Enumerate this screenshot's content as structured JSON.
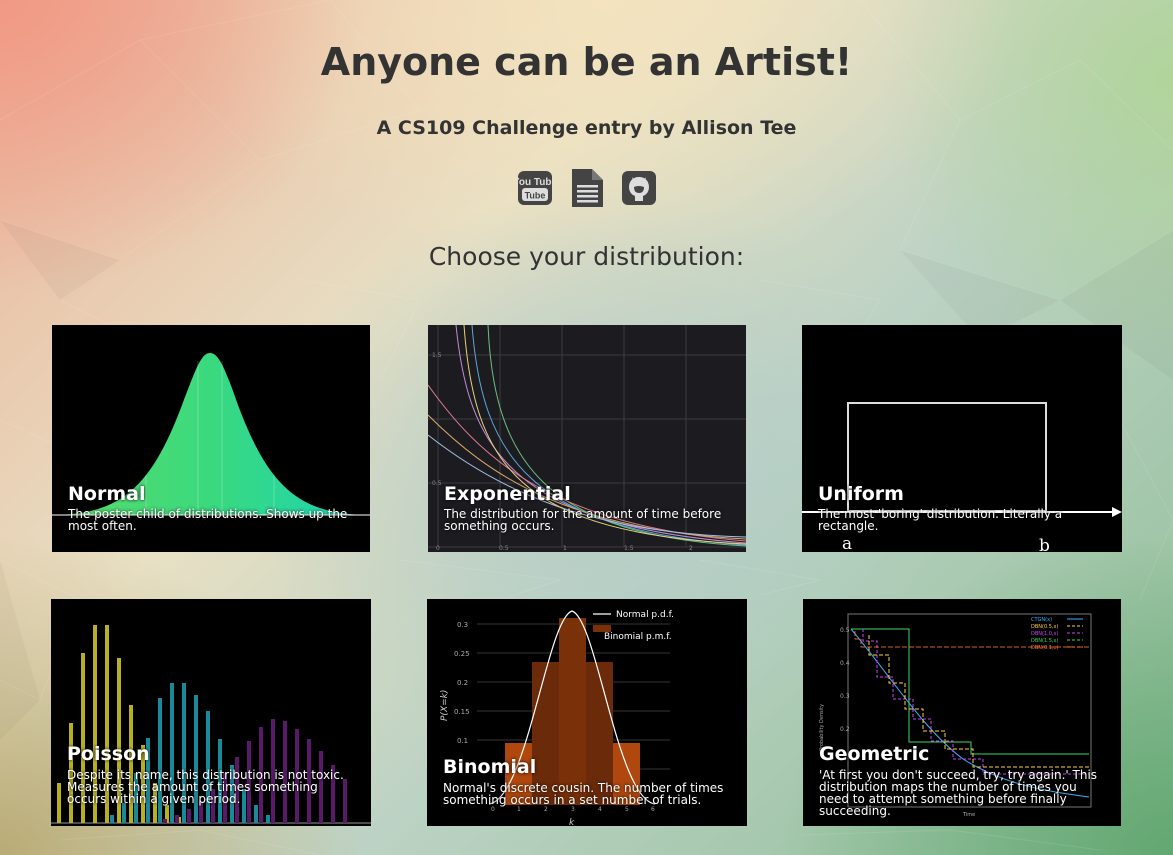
{
  "header": {
    "title": "Anyone can be an Artist!",
    "subtitle": "A CS109 Challenge entry by Allison Tee",
    "links": [
      {
        "icon": "youtube-icon",
        "label": "You Tube"
      },
      {
        "icon": "document-icon"
      },
      {
        "icon": "github-icon"
      }
    ]
  },
  "prompt": "Choose your distribution:",
  "cards": {
    "normal": {
      "name": "Normal",
      "description": "The poster child of distributions. Shows up the most often."
    },
    "exponential": {
      "name": "Exponential",
      "description": "The distribution for the amount of time before something occurs.",
      "y_ticks": [
        "1.5",
        "0.5"
      ],
      "x_ticks": [
        "0",
        "0.5",
        "1",
        "1.5",
        "2"
      ]
    },
    "uniform": {
      "name": "Uniform",
      "description": "The most 'boring' distribution. Literally a rectangle.",
      "label_a": "a",
      "label_b": "b"
    },
    "poisson": {
      "name": "Poisson",
      "description": "Despite its name, this distribution is not toxic. Measures the amount of times something occurs within a given period."
    },
    "binomial": {
      "name": "Binomial",
      "description": "Normal's discrete cousin. The number of times something occurs in a set number of trials.",
      "legend": [
        "Normal p.d.f.",
        "Binomial p.m.f."
      ],
      "ylabel": "P(X=k)",
      "xlabel": "k",
      "y_ticks": [
        "0.3",
        "0.25",
        "0.2",
        "0.15",
        "0.1"
      ],
      "x_ticks": [
        "0",
        "1",
        "2",
        "3",
        "4",
        "5",
        "6"
      ]
    },
    "geometric": {
      "name": "Geometric",
      "description": "'At first you don't succeed, try, try again.' This distribution maps the number of times you need to attempt something before finally succeeding.",
      "legend": [
        "CTGN(x)",
        "DBN(0.5,x)",
        "DBN(1.0,x)",
        "DBN(1.5,x)",
        "DBN(0.1,x)"
      ],
      "legend_colors": [
        "#3ab0ff",
        "#ffd23a",
        "#d040ff",
        "#3ad860",
        "#ff7a3a"
      ],
      "ylabel": "Probability Density",
      "xlabel": "Time",
      "y_ticks": [
        "0.5",
        "0.4",
        "0.3",
        "0.2"
      ]
    }
  }
}
